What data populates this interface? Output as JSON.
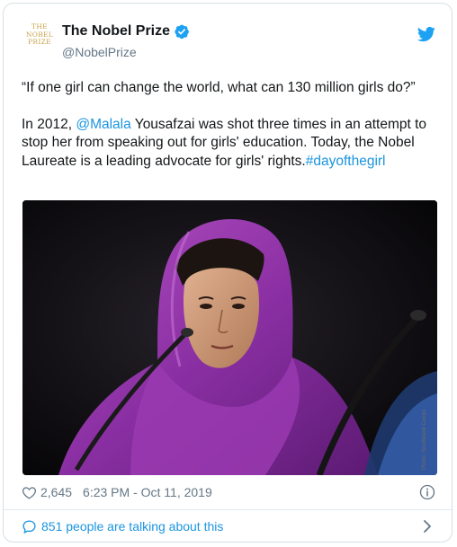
{
  "account": {
    "logo_lines": [
      "THE",
      "NOBEL",
      "PRIZE"
    ],
    "name": "The Nobel Prize",
    "handle": "@NobelPrize",
    "verified": true
  },
  "tweet": {
    "quote": "“If one girl can change the world, what can 130 million girls do?”",
    "body_prefix": "In 2012,",
    "mention": "@Malala",
    "body_middle": " Yousafzai was shot three times in an attempt to stop her from speaking out for girls' education. Today, the Nobel Laureate is a leading advocate for girls' rights.",
    "hashtag": "#dayofthegirl"
  },
  "media": {
    "description": "Portrait photo",
    "watermark": "Photo: Southbank Centre"
  },
  "meta": {
    "likes": "2,645",
    "timestamp": "6:23 PM - Oct 11, 2019"
  },
  "footer": {
    "talking": "851 people are talking about this"
  },
  "colors": {
    "link": "#1b95e0",
    "muted": "#657786",
    "verified": "#1da1f2",
    "logo_gold": "#c9a24a"
  },
  "icons": [
    "verified-badge-icon",
    "twitter-bird-icon",
    "heart-icon",
    "info-icon",
    "comment-bubble-icon",
    "chevron-right-icon"
  ]
}
